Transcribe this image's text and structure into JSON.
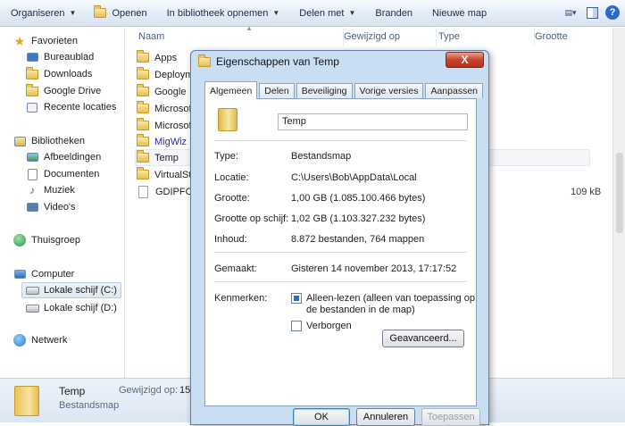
{
  "toolbar": {
    "organize": "Organiseren",
    "open": "Openen",
    "include_library": "In bibliotheek opnemen",
    "share": "Delen met",
    "burn": "Branden",
    "new_folder": "Nieuwe map"
  },
  "nav": {
    "favorites": "Favorieten",
    "desktop": "Bureaublad",
    "downloads": "Downloads",
    "google_drive": "Google Drive",
    "recent": "Recente locaties",
    "libraries": "Bibliotheken",
    "pictures": "Afbeeldingen",
    "documents": "Documenten",
    "music": "Muziek",
    "videos": "Video's",
    "homegroup": "Thuisgroep",
    "computer": "Computer",
    "drive_c": "Lokale schijf (C:)",
    "drive_d": "Lokale schijf (D:)",
    "network": "Netwerk"
  },
  "list": {
    "col_name": "Naam",
    "col_modified": "Gewijzigd op",
    "col_type": "Type",
    "col_size": "Grootte",
    "rows": [
      {
        "name": "Apps"
      },
      {
        "name": "Deploym"
      },
      {
        "name": "Google"
      },
      {
        "name": "Microsof"
      },
      {
        "name": "Microsof"
      },
      {
        "name": "MigWiz"
      },
      {
        "name": "Temp"
      },
      {
        "name": "VirtualSto"
      },
      {
        "name": "GDIPFON",
        "size": "109 kB"
      }
    ]
  },
  "details": {
    "name": "Temp",
    "type": "Bestandsmap",
    "modified_label": "Gewijzigd op:",
    "modified_value": "15"
  },
  "dialog": {
    "title": "Eigenschappen van Temp",
    "close": "X",
    "tabs": [
      "Algemeen",
      "Delen",
      "Beveiliging",
      "Vorige versies",
      "Aanpassen"
    ],
    "folder_name": "Temp",
    "type_label": "Type:",
    "type_value": "Bestandsmap",
    "location_label": "Locatie:",
    "location_value": "C:\\Users\\Bob\\AppData\\Local",
    "size_label": "Grootte:",
    "size_value": "1,00 GB (1.085.100.466 bytes)",
    "disk_size_label": "Grootte op schijf:",
    "disk_size_value": "1,02 GB (1.103.327.232 bytes)",
    "contents_label": "Inhoud:",
    "contents_value": "8.872 bestanden, 764 mappen",
    "created_label": "Gemaakt:",
    "created_value": "Gisteren 14 november 2013, 17:17:52",
    "attributes_label": "Kenmerken:",
    "readonly_label": "Alleen-lezen (alleen van toepassing op de bestanden in de map)",
    "readonly_checked": true,
    "hidden_label": "Verborgen",
    "hidden_checked": false,
    "advanced_button": "Geavanceerd...",
    "ok_button": "OK",
    "cancel_button": "Annuleren",
    "apply_button": "Toepassen"
  }
}
